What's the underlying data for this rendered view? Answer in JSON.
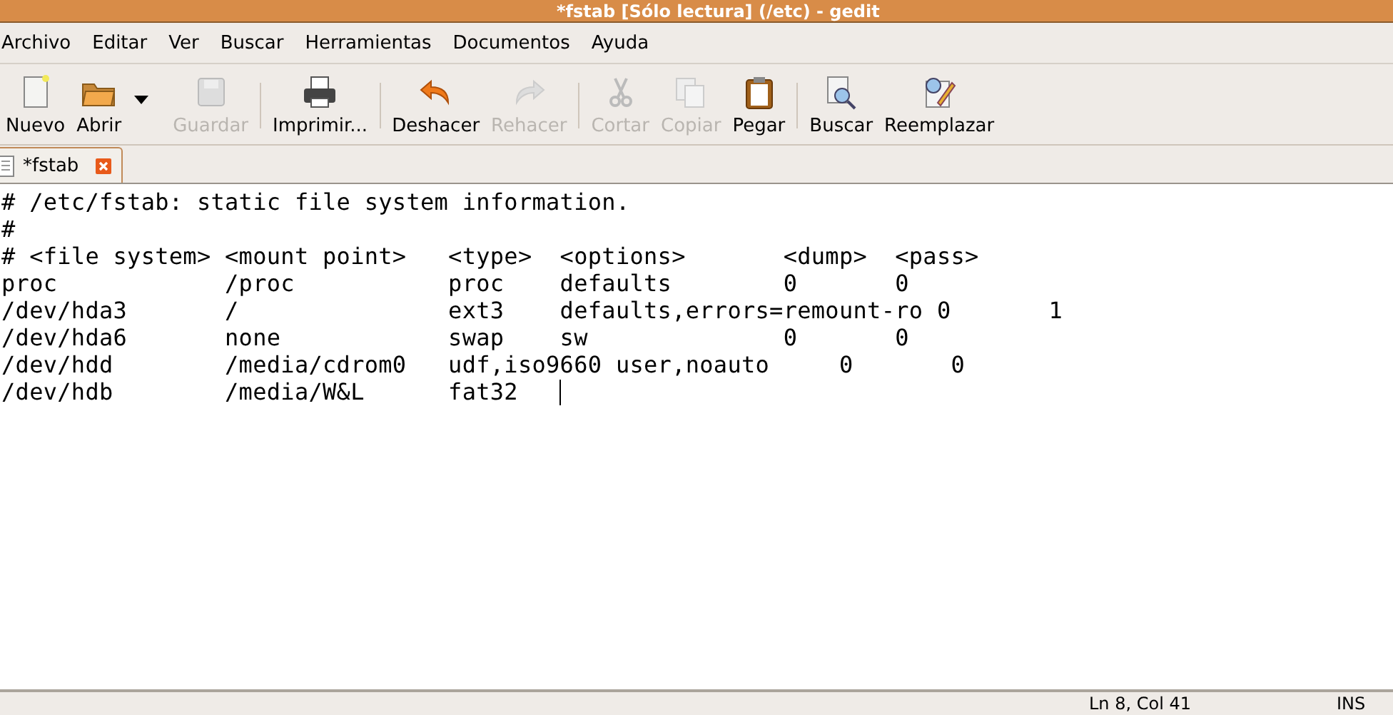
{
  "window": {
    "title": "*fstab [Sólo lectura] (/etc) - gedit"
  },
  "menu": [
    "Archivo",
    "Editar",
    "Ver",
    "Buscar",
    "Herramientas",
    "Documentos",
    "Ayuda"
  ],
  "toolbar": [
    {
      "kind": "button",
      "label": "Nuevo",
      "disabled": false
    },
    {
      "kind": "button",
      "label": "Abrir",
      "disabled": false
    },
    {
      "kind": "dropdown",
      "disabled": false
    },
    {
      "kind": "button",
      "label": "Guardar",
      "disabled": true
    },
    {
      "kind": "separator"
    },
    {
      "kind": "button",
      "label": "Imprimir...",
      "disabled": false
    },
    {
      "kind": "separator"
    },
    {
      "kind": "button",
      "label": "Deshacer",
      "disabled": false
    },
    {
      "kind": "button",
      "label": "Rehacer",
      "disabled": true
    },
    {
      "kind": "separator"
    },
    {
      "kind": "button",
      "label": "Cortar",
      "disabled": true
    },
    {
      "kind": "button",
      "label": "Copiar",
      "disabled": true
    },
    {
      "kind": "button",
      "label": "Pegar",
      "disabled": false
    },
    {
      "kind": "separator"
    },
    {
      "kind": "button",
      "label": "Buscar",
      "disabled": false
    },
    {
      "kind": "button",
      "label": "Reemplazar",
      "disabled": false
    }
  ],
  "tabs": [
    {
      "label": "*fstab",
      "selected": true
    }
  ],
  "editor": {
    "lines": [
      {
        "text": "# /etc/fstab: static file system information.",
        "cursor": false
      },
      {
        "text": "#",
        "cursor": false
      },
      {
        "text": "# <file system> <mount point>   <type>  <options>       <dump>  <pass>",
        "cursor": false
      },
      {
        "text": "proc            /proc           proc    defaults        0       0",
        "cursor": false
      },
      {
        "text": "/dev/hda3       /               ext3    defaults,errors=remount-ro 0       1",
        "cursor": false
      },
      {
        "text": "/dev/hda6       none            swap    sw              0       0",
        "cursor": false
      },
      {
        "text": "/dev/hdd        /media/cdrom0   udf,iso9660 user,noauto     0       0",
        "cursor": false
      },
      {
        "text": "/dev/hdb        /media/W&L      fat32   ",
        "cursor": true
      }
    ]
  },
  "status_bar": {
    "position": "Ln 8, Col 41",
    "mode": "INS"
  }
}
